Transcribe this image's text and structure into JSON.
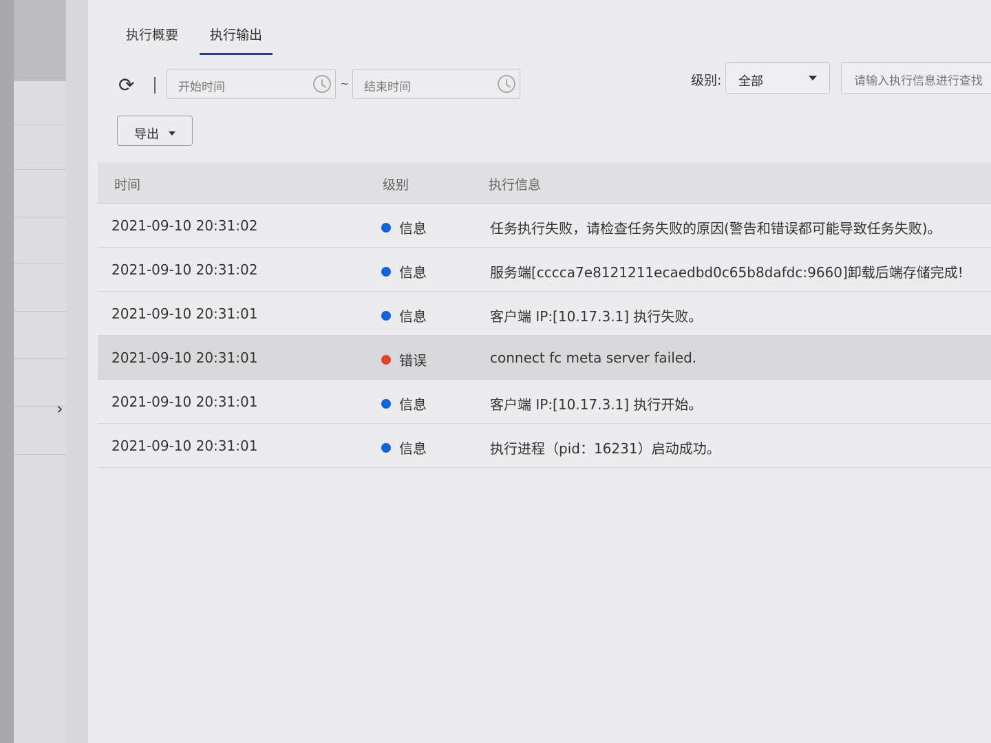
{
  "colors": {
    "info_dot": "#1463d8",
    "error_dot": "#e0452c",
    "tab_underline": "#2f3d7a"
  },
  "tabs": [
    {
      "label": "执行概要"
    },
    {
      "label": "执行输出"
    }
  ],
  "toolbar": {
    "start_placeholder": "开始时间",
    "end_placeholder": "结束时间",
    "separator": "~",
    "level_label": "级别:",
    "level_value": "全部",
    "search_placeholder": "请输入执行信息进行查找",
    "export_label": "导出"
  },
  "table": {
    "headers": {
      "time": "时间",
      "level": "级别",
      "message": "执行信息"
    },
    "rows": [
      {
        "time": "2021-09-10 20:31:02",
        "level": "信息",
        "level_type": "info",
        "message": "任务执行失败，请检查任务失败的原因(警告和错误都可能导致任务失败)。"
      },
      {
        "time": "2021-09-10 20:31:02",
        "level": "信息",
        "level_type": "info",
        "message": "服务端[cccca7e8121211ecaedbd0c65b8dafdc:9660]卸载后端存储完成!"
      },
      {
        "time": "2021-09-10 20:31:01",
        "level": "信息",
        "level_type": "info",
        "message": "客户端 IP:[10.17.3.1] 执行失败。"
      },
      {
        "time": "2021-09-10 20:31:01",
        "level": "错误",
        "level_type": "error",
        "message": "connect fc meta server failed."
      },
      {
        "time": "2021-09-10 20:31:01",
        "level": "信息",
        "level_type": "info",
        "message": "客户端 IP:[10.17.3.1] 执行开始。"
      },
      {
        "time": "2021-09-10 20:31:01",
        "level": "信息",
        "level_type": "info",
        "message": "执行进程（pid：16231）启动成功。"
      }
    ]
  }
}
